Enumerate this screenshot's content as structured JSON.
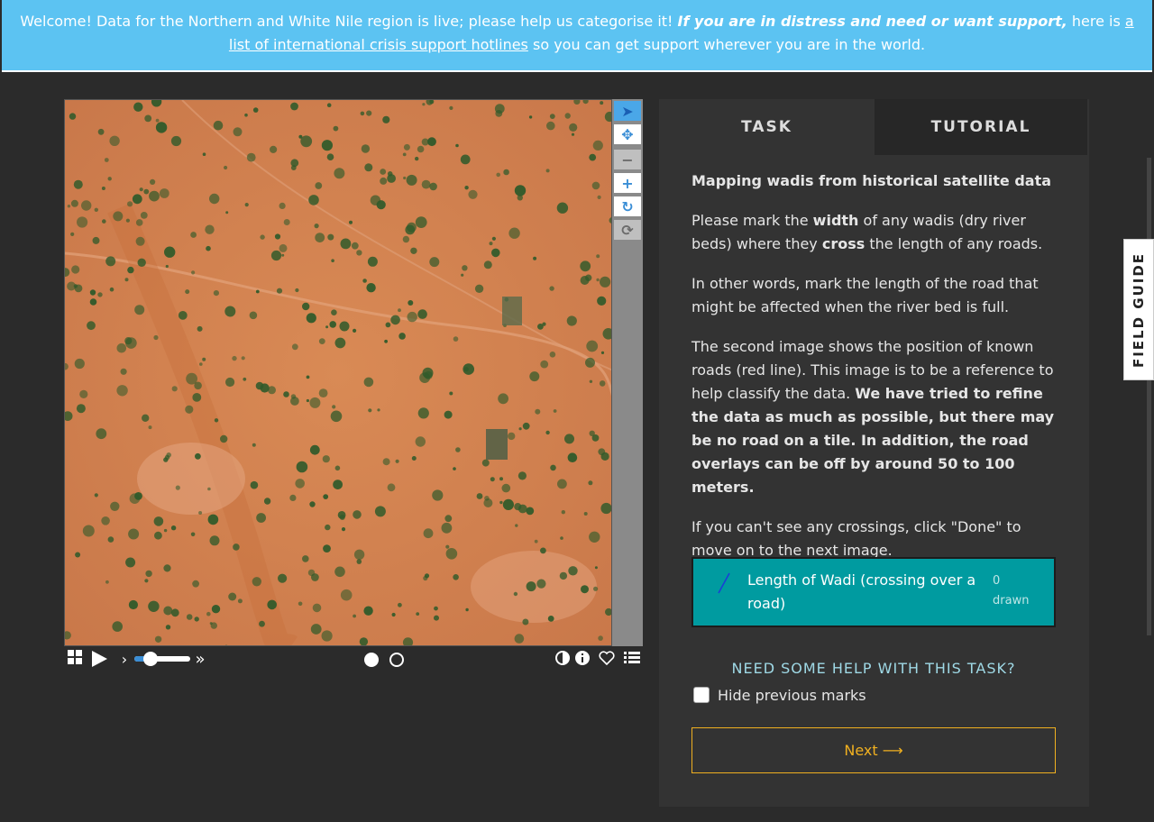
{
  "banner": {
    "text_before": "Welcome! Data for the Northern and White Nile region is live; please help us categorise it! ",
    "emphasis": "If you are in distress and need or want support,",
    "text_middle": " here is ",
    "link": "a list of international crisis support hotlines",
    "text_after": " so you can get support wherever you are in the world."
  },
  "viewer": {
    "toolbar_icons": [
      "pointer-icon",
      "move-icon",
      "zoom-out-icon",
      "zoom-in-icon",
      "rotate-icon",
      "reset-icon"
    ],
    "bottom_icons": [
      "grid-icon",
      "play-icon",
      "slower-icon",
      "speed-slider",
      "faster-icon",
      "frame-1-dot",
      "frame-2-dot",
      "contrast-icon",
      "info-icon",
      "favourite-icon",
      "list-icon"
    ]
  },
  "tabs": {
    "task": "TASK",
    "tutorial": "TUTORIAL"
  },
  "task": {
    "title": "Mapping wadis from historical satellite data",
    "p1_a": "Please mark the ",
    "p1_b": "width",
    "p1_c": " of any wadis (dry river beds) where they ",
    "p1_d": "cross",
    "p1_e": " the length of any roads.",
    "p2": "In other words, mark the length of the road that might be affected when the river bed is full.",
    "p3_a": "The second image shows the position of known roads (red line). This image is to be a reference to help classify the data. ",
    "p3_b": "We have tried to refine the data as much as possible, but there may be no road on a tile. In addition, the road overlays can be off by around 50 to 100 meters.",
    "p4": "If you can't see any crossings, click \"Done\" to move on to the next image.",
    "tool": {
      "label": "Length of Wadi (crossing over a road)",
      "count": "0",
      "count_suffix": "drawn",
      "color": "#1a3fd6"
    },
    "help": "NEED SOME HELP WITH THIS TASK?",
    "hide_marks": "Hide previous marks",
    "next": "Next",
    "next_arrow": "⟶"
  },
  "field_guide": "FIELD GUIDE",
  "colors": {
    "banner": "#5cc3f2",
    "tool_bg": "#009ba0",
    "next": "#f0b020",
    "toolbar_accent": "#3a8ed6"
  }
}
